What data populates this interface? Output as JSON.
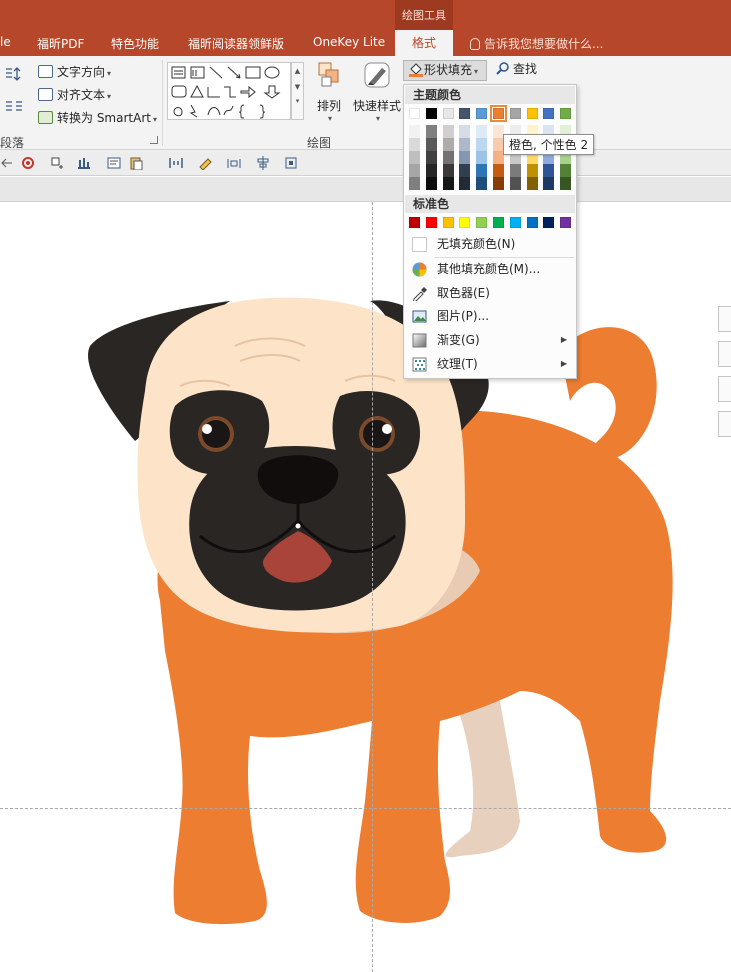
{
  "tabbar": {
    "context_group_label": "绘图工具",
    "tabs": [
      {
        "label": "le"
      },
      {
        "label": "福昕PDF"
      },
      {
        "label": "特色功能"
      },
      {
        "label": "福昕阅读器领鲜版"
      },
      {
        "label": "OneKey Lite"
      }
    ],
    "active_tab": "格式",
    "tell_me": "告诉我您想要做什么..."
  },
  "ribbon": {
    "paragraph": {
      "text_direction": "文字方向",
      "align_text": "对齐文本",
      "convert_smartart": "转换为 SmartArt",
      "group_label": "段落"
    },
    "drawing": {
      "arrange": "排列",
      "quick_styles": "快速样式",
      "shape_fill": "形状填充",
      "group_label": "绘图"
    },
    "editing": {
      "find": "查找"
    }
  },
  "fill_menu": {
    "theme_colors_header": "主题颜色",
    "standard_colors_header": "标准色",
    "theme_colors": [
      "#ffffff",
      "#000000",
      "#e7e6e6",
      "#44546a",
      "#5b9bd5",
      "#ed7d31",
      "#a5a5a5",
      "#ffc000",
      "#4472c4",
      "#70ad47"
    ],
    "theme_shades": [
      [
        "#f2f2f2",
        "#d9d9d9",
        "#bfbfbf",
        "#a6a6a6",
        "#7f7f7f"
      ],
      [
        "#7f7f7f",
        "#595959",
        "#404040",
        "#262626",
        "#0d0d0d"
      ],
      [
        "#d0cece",
        "#aeabab",
        "#757171",
        "#3a3838",
        "#171616"
      ],
      [
        "#d6dce5",
        "#adb9ca",
        "#8497b0",
        "#333f50",
        "#222a35"
      ],
      [
        "#deebf7",
        "#bdd7ee",
        "#9dc3e6",
        "#2e75b6",
        "#1f4e79"
      ],
      [
        "#fbe5d6",
        "#f8cbad",
        "#f4b183",
        "#c55a11",
        "#843c0c"
      ],
      [
        "#ededed",
        "#dbdbdb",
        "#c9c9c9",
        "#7b7b7b",
        "#525252"
      ],
      [
        "#fff2cc",
        "#ffe699",
        "#ffd966",
        "#bf9000",
        "#806000"
      ],
      [
        "#dae3f3",
        "#b4c7e7",
        "#8faadc",
        "#2f5597",
        "#203864"
      ],
      [
        "#e2f0d9",
        "#c5e0b4",
        "#a9d18e",
        "#538135",
        "#375623"
      ]
    ],
    "standard_colors": [
      "#c00000",
      "#ff0000",
      "#ffc000",
      "#ffff00",
      "#92d050",
      "#00b050",
      "#00b0f0",
      "#0070c0",
      "#002060",
      "#7030a0"
    ],
    "no_fill": "无填充颜色(N)",
    "more_colors": "其他填充颜色(M)...",
    "eyedropper": "取色器(E)",
    "picture": "图片(P)...",
    "gradient": "渐变(G)",
    "texture": "纹理(T)",
    "tooltip": "橙色, 个性色 2",
    "selected_color": "#ed7d31"
  },
  "slide": {
    "illustration": "pug-dog",
    "body_color": "#ed7d31",
    "face_color": "#fde4c8",
    "mask_color": "#2a2624",
    "tongue_color": "#a8443a"
  }
}
